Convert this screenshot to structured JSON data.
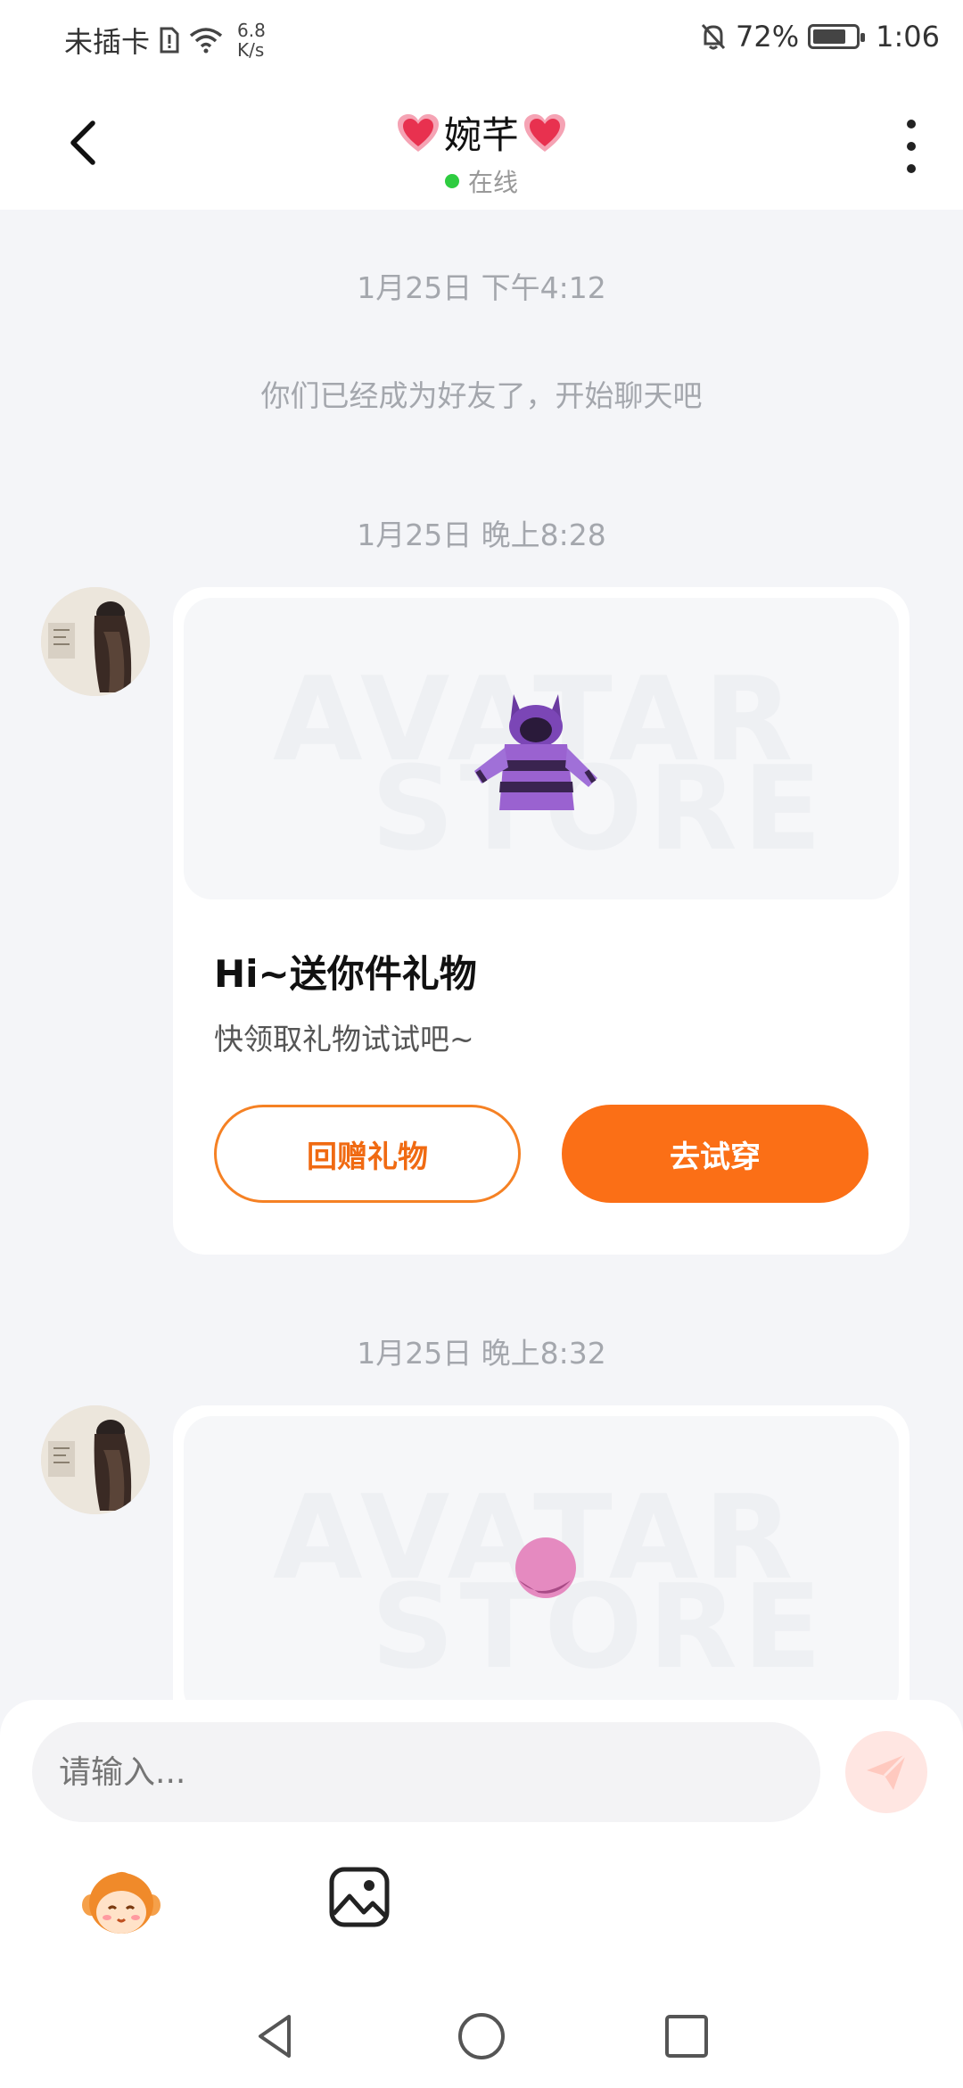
{
  "status_bar": {
    "carrier": "未插卡",
    "speed_value": "6.8",
    "speed_unit": "K/s",
    "battery": "72%",
    "battery_level": 0.72,
    "time": "1:06"
  },
  "header": {
    "contact_name": "婉芊",
    "status": "在线"
  },
  "messages": {
    "stamp1": "1月25日 下午4:12",
    "system_text": "你们已经成为好友了，开始聊天吧",
    "stamp2": "1月25日 晚上8:28",
    "stamp3": "1月25日 晚上8:32",
    "card1": {
      "watermark_line1": "AVATAR",
      "watermark_line2": "STORE",
      "title": "Hi~送你件礼物",
      "subtitle": "快领取礼物试试吧~",
      "btn_return_gift": "回赠礼物",
      "btn_try_on": "去试穿"
    },
    "card2": {
      "watermark_line1": "AVATAR",
      "watermark_line2": "STORE"
    }
  },
  "input_bar": {
    "placeholder": "请输入..."
  },
  "colors": {
    "accent": "#fb6f16",
    "online": "#2ecc40",
    "background": "#f4f5f8"
  },
  "icons": [
    "back-arrow-icon",
    "heart-icon",
    "more-vert-icon",
    "send-icon",
    "emoji-avatar-icon",
    "image-icon",
    "nav-back-icon",
    "nav-home-icon",
    "nav-recents-icon"
  ]
}
